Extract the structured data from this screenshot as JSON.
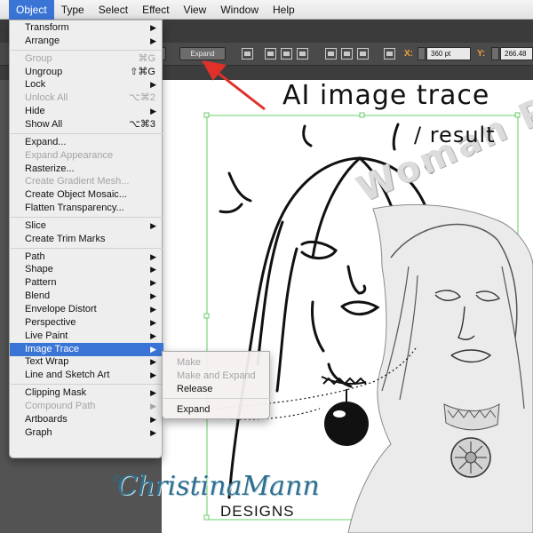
{
  "menubar": {
    "items": [
      {
        "label": "Object",
        "active": true
      },
      {
        "label": "Type",
        "active": false
      },
      {
        "label": "Select",
        "active": false
      },
      {
        "label": "Effect",
        "active": false
      },
      {
        "label": "View",
        "active": false
      },
      {
        "label": "Window",
        "active": false
      },
      {
        "label": "Help",
        "active": false
      }
    ]
  },
  "control_bar": {
    "expand_label": "Expand",
    "x_label": "X:",
    "x_value": "360 pt",
    "y_label": "Y:",
    "y_value": "266.48"
  },
  "object_menu": {
    "items": [
      {
        "label": "Transform",
        "arrow": true
      },
      {
        "label": "Arrange",
        "arrow": true
      },
      {
        "sep": true
      },
      {
        "label": "Group",
        "shortcut": "⌘G",
        "disabled": true
      },
      {
        "label": "Ungroup",
        "shortcut": "⇧⌘G"
      },
      {
        "label": "Lock",
        "arrow": true
      },
      {
        "label": "Unlock All",
        "shortcut": "⌥⌘2",
        "disabled": true
      },
      {
        "label": "Hide",
        "arrow": true
      },
      {
        "label": "Show All",
        "shortcut": "⌥⌘3"
      },
      {
        "sep": true
      },
      {
        "label": "Expand..."
      },
      {
        "label": "Expand Appearance",
        "disabled": true
      },
      {
        "label": "Rasterize..."
      },
      {
        "label": "Create Gradient Mesh...",
        "disabled": true
      },
      {
        "label": "Create Object Mosaic..."
      },
      {
        "label": "Flatten Transparency..."
      },
      {
        "sep": true
      },
      {
        "label": "Slice",
        "arrow": true
      },
      {
        "label": "Create Trim Marks"
      },
      {
        "sep": true
      },
      {
        "label": "Path",
        "arrow": true
      },
      {
        "label": "Shape",
        "arrow": true
      },
      {
        "label": "Pattern",
        "arrow": true
      },
      {
        "label": "Blend",
        "arrow": true
      },
      {
        "label": "Envelope Distort",
        "arrow": true
      },
      {
        "label": "Perspective",
        "arrow": true
      },
      {
        "label": "Live Paint",
        "arrow": true
      },
      {
        "label": "Image Trace",
        "arrow": true,
        "highlighted": true
      },
      {
        "label": "Text Wrap",
        "arrow": true
      },
      {
        "label": "Line and Sketch Art",
        "arrow": true
      },
      {
        "sep": true
      },
      {
        "label": "Clipping Mask",
        "arrow": true
      },
      {
        "label": "Compound Path",
        "arrow": true,
        "disabled": true
      },
      {
        "label": "Artboards",
        "arrow": true
      },
      {
        "label": "Graph",
        "arrow": true
      }
    ]
  },
  "image_trace_submenu": {
    "items": [
      {
        "label": "Make",
        "disabled": true
      },
      {
        "label": "Make and Expand",
        "disabled": true
      },
      {
        "label": "Release"
      },
      {
        "sep": true
      },
      {
        "label": "Expand"
      }
    ]
  },
  "annotation": {
    "line1": "AI image trace",
    "line2": "/ result"
  },
  "photo_overlay_text": "Woman R",
  "branding": {
    "copyright": "©",
    "name": "ChristinaMann",
    "sub": "DESIGNS"
  },
  "colors": {
    "menu_highlight": "#3a75d6",
    "arrow_red": "#e0302a",
    "brand_blue": "#2f6e8e",
    "selection_green": "#66cc66"
  },
  "icons": [
    "arrow-right-icon",
    "align-icon",
    "grid-icon",
    "stepper-icon"
  ]
}
